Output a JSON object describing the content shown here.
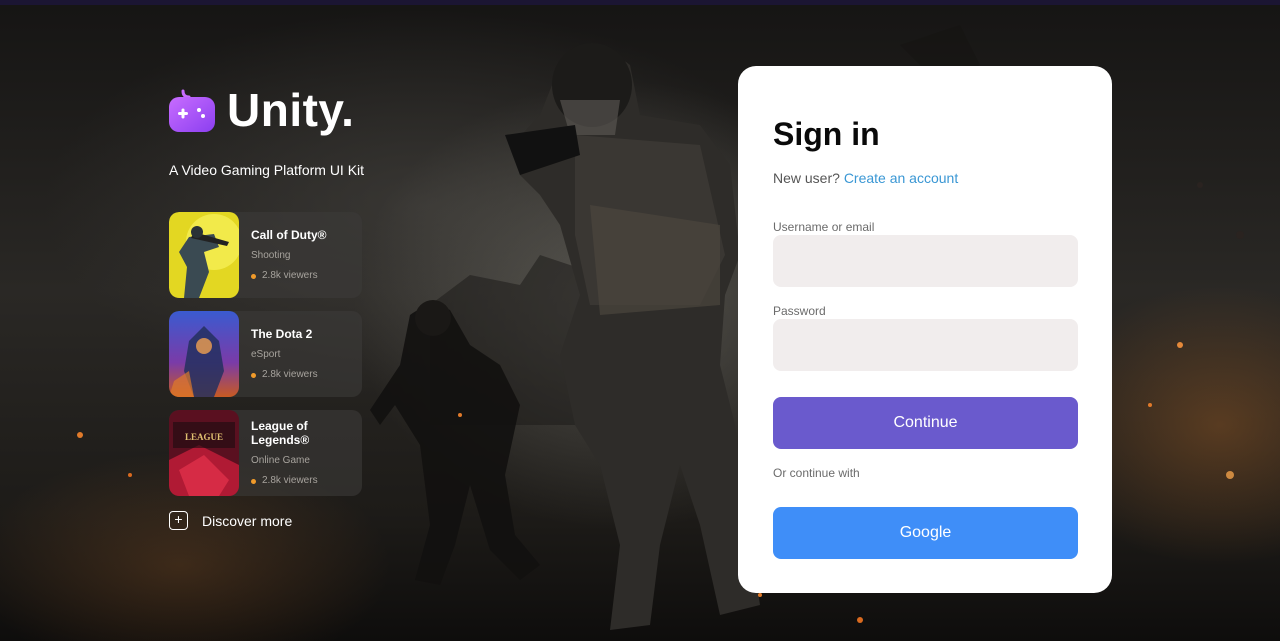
{
  "brand": {
    "name": "Unity.",
    "tagline": "A Video Gaming Platform UI Kit"
  },
  "games": [
    {
      "title": "Call of Duty®",
      "genre": "Shooting",
      "viewers": "2.8k viewers"
    },
    {
      "title": "The Dota 2",
      "genre": "eSport",
      "viewers": "2.8k viewers"
    },
    {
      "title": "League of Legends®",
      "genre": "Online Game",
      "viewers": "2.8k viewers",
      "thumb_text": "LEAGUE OF LEGENDS"
    }
  ],
  "discover": {
    "label": "Discover more",
    "icon": "plus-icon"
  },
  "signin": {
    "title": "Sign in",
    "new_user_text": "New user?",
    "create_link": "Create an account",
    "username_label": "Username or email",
    "username_value": "",
    "password_label": "Password",
    "password_value": "",
    "continue_label": "Continue",
    "or_text": "Or continue with",
    "google_label": "Google"
  },
  "colors": {
    "accent_purple": "#6a5acd",
    "google_blue": "#3f8ef8",
    "link_blue": "#3a97d4",
    "logo_purple": "#a855f7"
  }
}
